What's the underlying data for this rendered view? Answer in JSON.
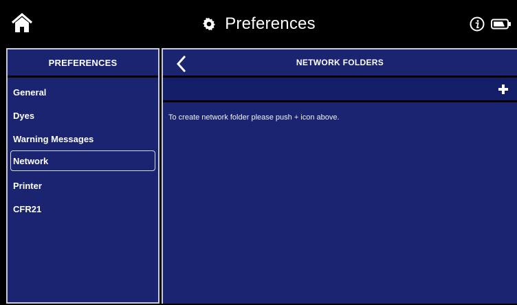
{
  "header": {
    "title": "Preferences",
    "home_icon": "home-icon",
    "title_icon": "gear-icon",
    "info_icon": "info-icon",
    "battery_icon": "battery-icon"
  },
  "sidebar": {
    "heading": "PREFERENCES",
    "items": [
      {
        "label": "General",
        "selected": false
      },
      {
        "label": "Dyes",
        "selected": false
      },
      {
        "label": "Warning Messages",
        "selected": false
      },
      {
        "label": "Network",
        "selected": true
      },
      {
        "label": "Printer",
        "selected": false
      },
      {
        "label": "CFR21",
        "selected": false
      }
    ]
  },
  "main": {
    "heading": "NETWORK FOLDERS",
    "back_icon": "chevron-left-icon",
    "add_icon": "plus-icon",
    "message": "To create network folder please push + icon above."
  },
  "colors": {
    "panel": "#1a2470",
    "bar": "#141d68",
    "background": "#000000",
    "border": "#c9ccd8"
  }
}
